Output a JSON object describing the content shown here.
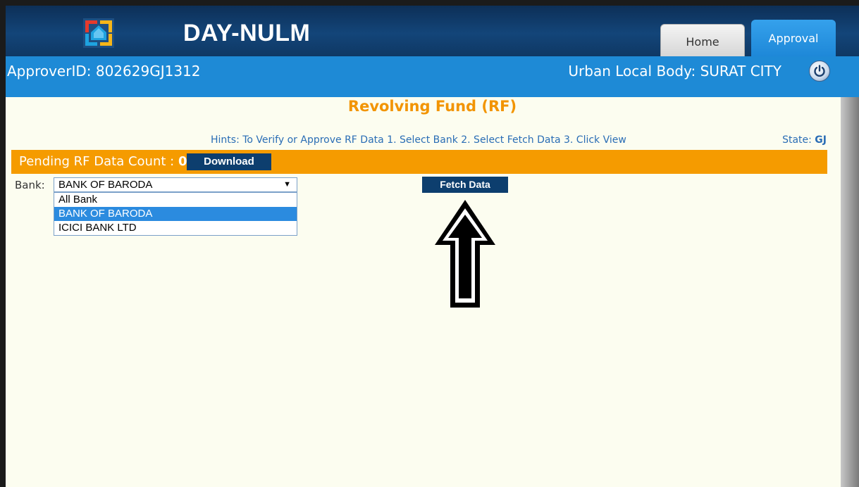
{
  "header": {
    "brand": "DAY-NULM",
    "tabs": [
      {
        "label": "Home",
        "active": false
      },
      {
        "label": "Approval",
        "active": true
      }
    ]
  },
  "user_bar": {
    "approver": "ApproverID: 802629GJ1312",
    "urban_local_body": "Urban Local Body: SURAT CITY"
  },
  "page": {
    "title": "Revolving Fund (RF)",
    "hints": "Hints: To Verify or Approve RF Data 1. Select Bank 2. Select Fetch Data 3. Click View",
    "state_label": "State:",
    "state_value": "GJ"
  },
  "pending": {
    "label": "Pending RF Data Count :",
    "count": "0",
    "download_label": "Download"
  },
  "bank_filter": {
    "label": "Bank:",
    "selected": "BANK OF BARODA",
    "options": [
      "All Bank",
      "BANK OF BARODA",
      "ICICI BANK LTD"
    ],
    "highlighted_index": 1
  },
  "fetch_label": "Fetch Data",
  "colors": {
    "header_dark": "#134579",
    "bar_blue": "#1e8ad6",
    "accent_orange": "#f59b00",
    "button_navy": "#0d3e6e",
    "link_blue": "#2a6db5"
  },
  "icons": [
    "nulm-logo-icon",
    "power-icon",
    "chevron-down-icon",
    "up-arrow-icon"
  ]
}
